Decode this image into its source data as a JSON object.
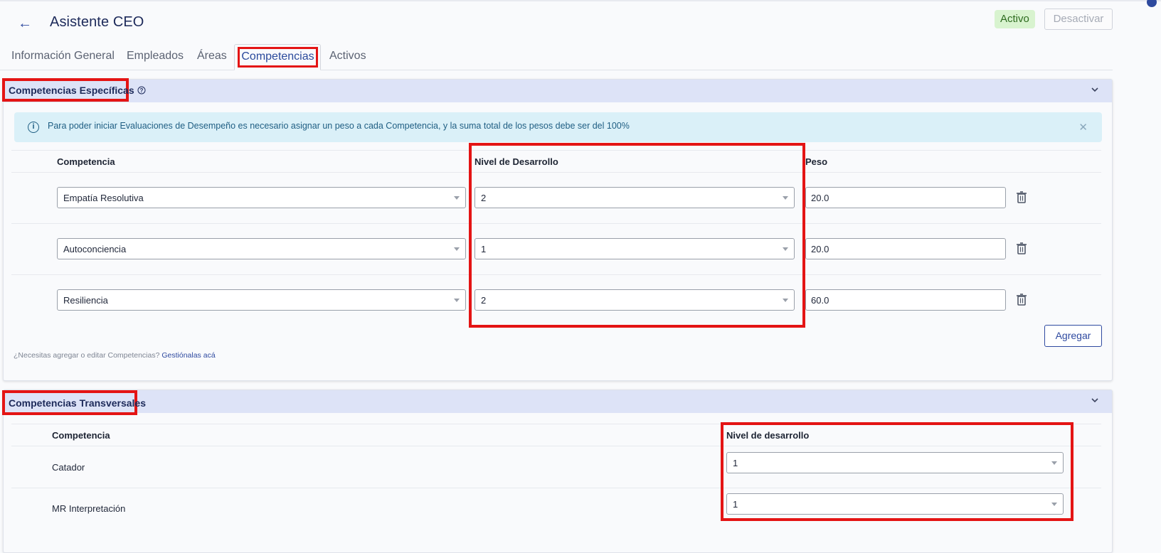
{
  "header": {
    "back_icon": "arrow-left-icon",
    "title": "Asistente CEO",
    "status_badge": "Activo",
    "deactivate_label": "Desactivar"
  },
  "tabs": [
    {
      "label": "Información General",
      "active": false
    },
    {
      "label": "Empleados",
      "active": false
    },
    {
      "label": "Áreas",
      "active": false
    },
    {
      "label": "Competencias",
      "active": true
    },
    {
      "label": "Activos",
      "active": false
    }
  ],
  "specific": {
    "title": "Competencias Específicas",
    "help_icon": "question-circle-icon",
    "alert": {
      "text": "Para poder iniciar Evaluaciones de Desempeño es necesario asignar un peso a cada Competencia, y la suma total de los pesos debe ser del 100%",
      "icon": "info-icon",
      "close_icon": "close-icon"
    },
    "columns": {
      "competencia": "Competencia",
      "nivel": "Nivel de Desarrollo",
      "peso": "Peso"
    },
    "rows": [
      {
        "competencia": "Empatía Resolutiva",
        "nivel": "2",
        "peso": "20.0"
      },
      {
        "competencia": "Autoconciencia",
        "nivel": "1",
        "peso": "20.0"
      },
      {
        "competencia": "Resiliencia",
        "nivel": "2",
        "peso": "60.0"
      }
    ],
    "add_label": "Agregar",
    "help_text": "¿Necesitas agregar o editar Competencias?",
    "help_link": "Gestiónalas acá"
  },
  "transversal": {
    "title": "Competencias Transversales",
    "columns": {
      "competencia": "Competencia",
      "nivel": "Nivel de desarrollo"
    },
    "rows": [
      {
        "competencia": "Catador",
        "nivel": "1"
      },
      {
        "competencia": "MR Interpretación",
        "nivel": "1"
      }
    ]
  },
  "colors": {
    "accent": "#2f4aa0",
    "highlight": "#e41414",
    "section_header": "#dde3f7",
    "alert_bg": "#daf0f8",
    "badge_bg": "#d8f3cf"
  }
}
